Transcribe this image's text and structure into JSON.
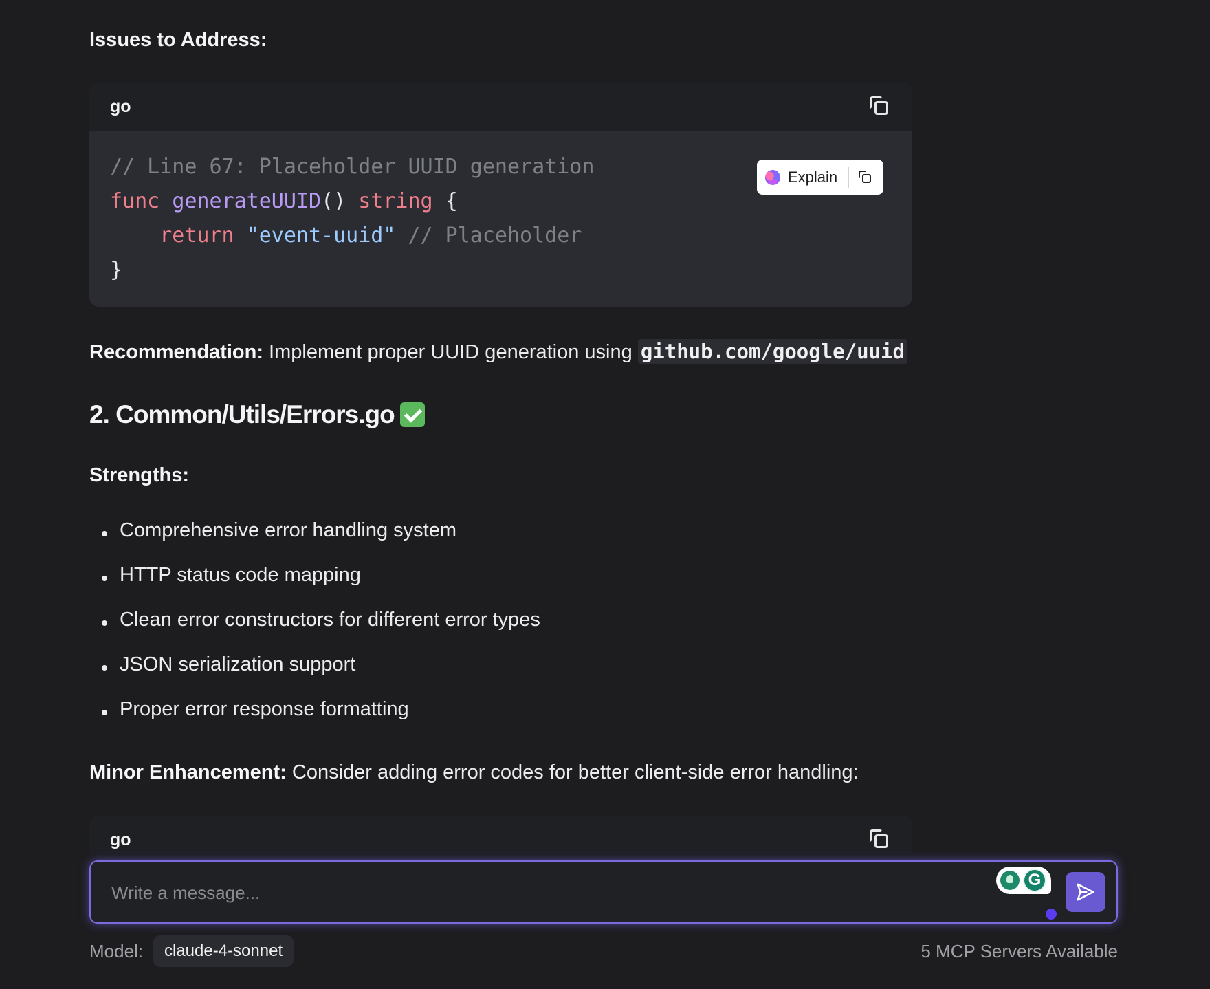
{
  "section1": {
    "issues_heading": "Issues to Address:",
    "code_block": {
      "language": "go",
      "lines": {
        "l1_comment": "// Line 67: Placeholder UUID generation",
        "l2_func": "func",
        "l2_name": "generateUUID",
        "l2_parens": "()",
        "l2_type": "string",
        "l2_brace": "{",
        "l3_indent": "    ",
        "l3_return": "return",
        "l3_string": "\"event-uuid\"",
        "l3_comment": "// Placeholder",
        "l4_brace": "}"
      },
      "explain_label": "Explain"
    },
    "recommendation_label": "Recommendation:",
    "recommendation_text": " Implement proper UUID generation using ",
    "recommendation_code": "github.com/google/uuid"
  },
  "section2": {
    "heading": "2. Common/Utils/Errors.go",
    "strengths_heading": "Strengths:",
    "strengths": [
      "Comprehensive error handling system",
      "HTTP status code mapping",
      "Clean error constructors for different error types",
      "JSON serialization support",
      "Proper error response formatting"
    ],
    "enhancement_label": "Minor Enhancement:",
    "enhancement_text": " Consider adding error codes for better client-side error handling:",
    "code_block_language": "go"
  },
  "composer": {
    "placeholder": "Write a message...",
    "value": ""
  },
  "footer": {
    "model_label": "Model:",
    "model_name": "claude-4-sonnet",
    "mcp_status": "5 MCP Servers Available"
  },
  "colors": {
    "background": "#1d1d20",
    "accent": "#6a5ad2",
    "check": "#5cb85c"
  }
}
